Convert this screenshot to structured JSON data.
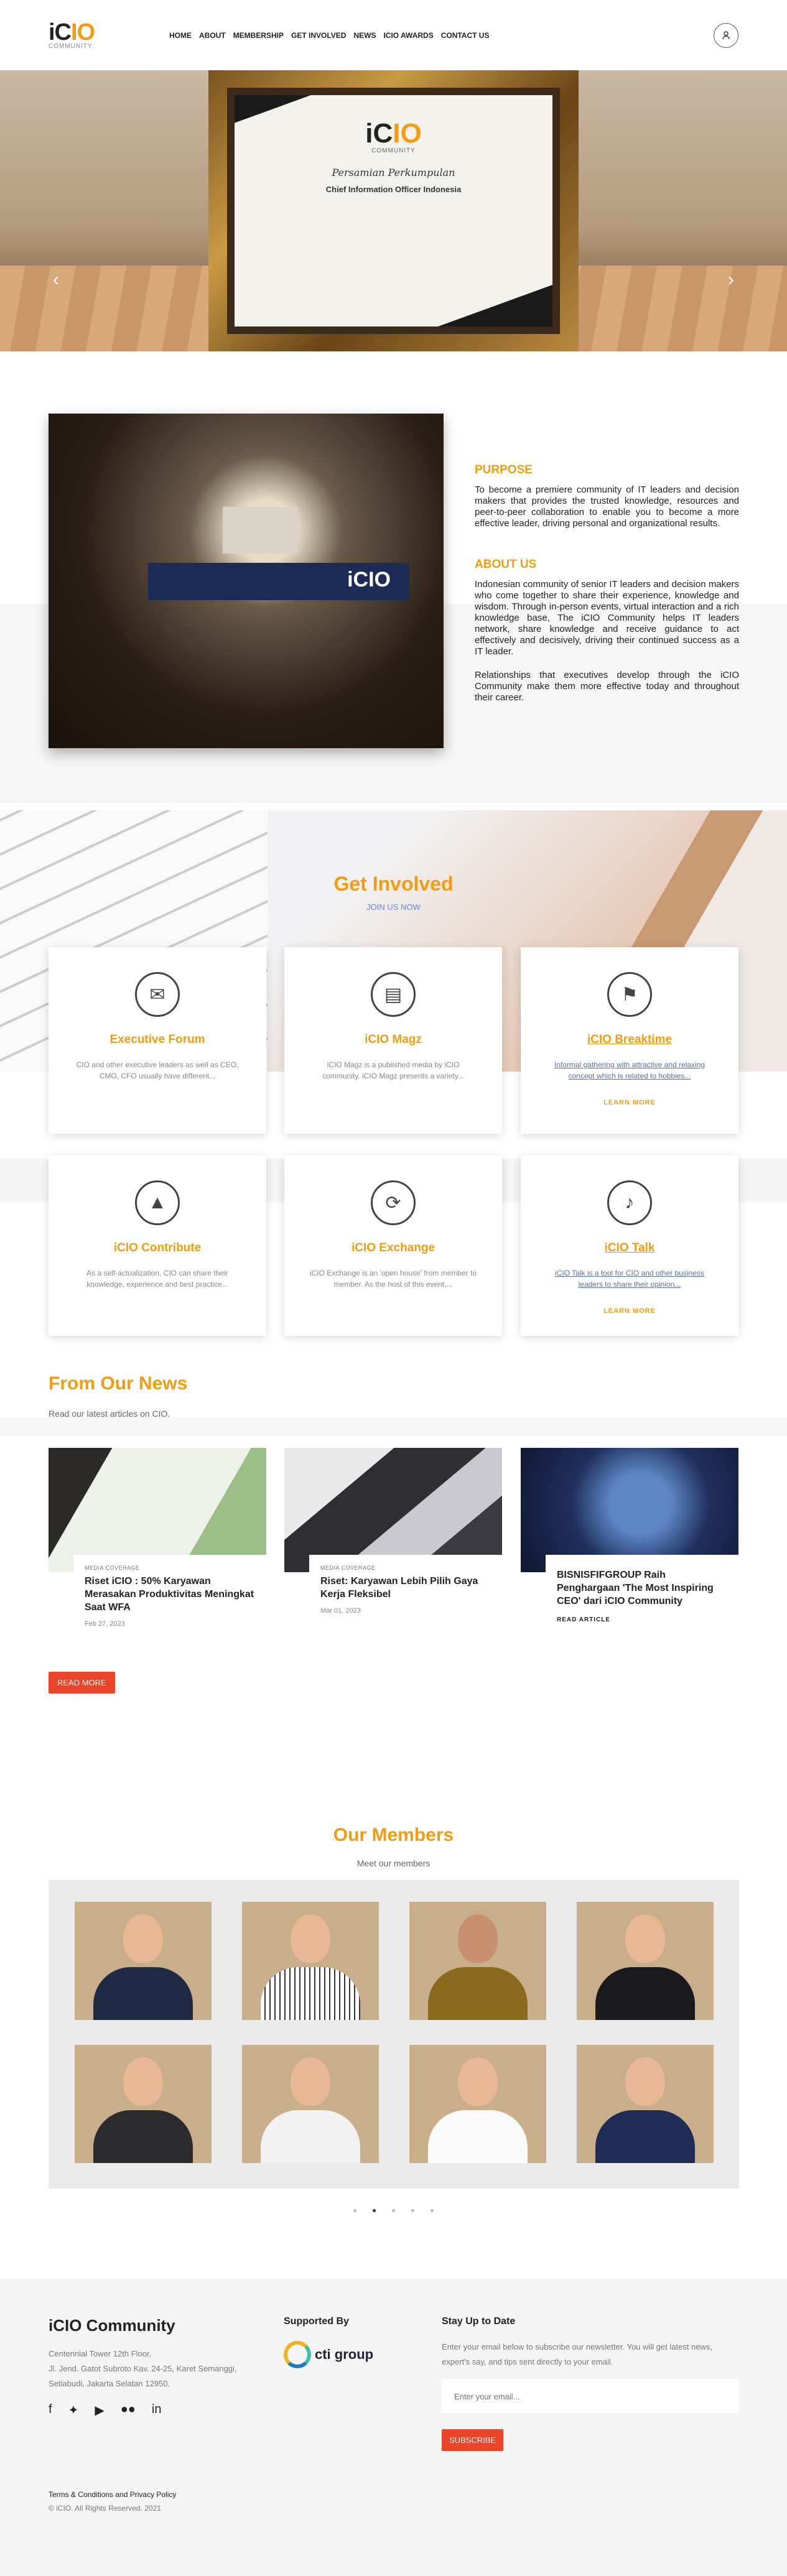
{
  "brand": {
    "logo_main": "iC",
    "logo_accent": "IO",
    "logo_sub": "COMMUNITY"
  },
  "nav": [
    "HOME",
    "ABOUT",
    "MEMBERSHIP",
    "GET INVOLVED",
    "NEWS",
    "ICIO AWARDS",
    "CONTACT US"
  ],
  "hero": {
    "cert_logo_main": "iC",
    "cert_logo_accent": "IO",
    "cert_sub": "COMMUNITY",
    "cert_title": "Persamian Perkumpulan",
    "cert_name": "Chief Information Officer Indonesia",
    "prev": "‹",
    "next": "›"
  },
  "about": {
    "stage_logo": "iCIO",
    "purpose_title": "PURPOSE",
    "purpose_text": "To become a premiere community of IT leaders and decision makers that provides the trusted knowledge, resources and peer-to-peer collaboration to enable you to become a more effective leader, driving personal and organizational results.",
    "about_title": "ABOUT US",
    "about_text_1": "Indonesian community of senior IT leaders and decision makers who come together to share their experience, knowledge and wisdom. Through in-person events, virtual interaction and a rich knowledge base, The iCIO Community helps IT leaders network, share knowledge and receive guidance to act effectively and decisively, driving their continued success as a IT leader.",
    "about_text_2": "Relationships that executives develop through the iCIO Community make them more effective today and throughout their career."
  },
  "involved": {
    "title": "Get Involved",
    "subtitle": "JOIN US NOW",
    "cards": [
      {
        "icon": "chat-icon",
        "glyph": "✉",
        "title": "Executive Forum",
        "text": "CIO and other executive leaders as well as CEO, CMO, CFO usually have different...",
        "more": ""
      },
      {
        "icon": "book-icon",
        "glyph": "▤",
        "title": "iCIO Magz",
        "text": "iCIO Magz is a published media by iCIO community. iCIO Magz presents a variety...",
        "more": ""
      },
      {
        "icon": "golf-icon",
        "glyph": "⚑",
        "title": "iCIO Breaktime",
        "text": "Informal gathering with attractive and relaxing concept which is related to hobbies...",
        "more": "LEARN MORE"
      },
      {
        "icon": "graduation-cap-icon",
        "glyph": "▲",
        "title": "iCIO Contribute",
        "text": "As a self-actualization, CIO can share their knowledge, experience and best practice...",
        "more": ""
      },
      {
        "icon": "exchange-icon",
        "glyph": "⟳",
        "title": "iCIO Exchange",
        "text": "iCIO Exchange is an 'open house' from member to member. As the host of this event,...",
        "more": ""
      },
      {
        "icon": "microphone-icon",
        "glyph": "♪",
        "title": "iCIO Talk",
        "text": "iCIO Talk is a tool for CIO and other business leaders to share their opinion...",
        "more": "LEARN MORE"
      }
    ]
  },
  "news": {
    "title": "From Our News",
    "subtitle": "Read our latest articles on CIO.",
    "posts": [
      {
        "category": "MEDIA COVERAGE",
        "title": "Riset iCIO : 50% Karyawan Merasakan Produktivitas Meningkat Saat WFA",
        "date": "Feb 27, 2023",
        "link": ""
      },
      {
        "category": "MEDIA COVERAGE",
        "title": "Riset: Karyawan Lebih Pilih Gaya Kerja Fleksibel",
        "date": "Mar 01, 2023",
        "link": ""
      },
      {
        "category": "",
        "title": "BISNISFIFGROUP Raih Penghargaan 'The Most Inspiring CEO' dari iCIO Community",
        "date": "",
        "link": "READ ARTICLE"
      }
    ],
    "read_more": "READ MORE"
  },
  "members": {
    "title": "Our Members",
    "subtitle": "Meet our members",
    "count": 8,
    "pages": 5,
    "active_page": 2
  },
  "footer": {
    "title": "iCIO Community",
    "address_1": "Centennial Tower 12th Floor,",
    "address_2": "Jl. Jend. Gatot Subroto Kav. 24-25, Karet Semanggi,",
    "address_3": "Setiabudi, Jakarta Selatan 12950.",
    "supported_title": "Supported By",
    "supporter": "cti group",
    "newsletter_title": "Stay Up to Date",
    "newsletter_text": "Enter your email below to subscribe our newsletter. You will get latest news, expert's say, and tips sent directly to your email.",
    "email_placeholder": "Enter your email...",
    "subscribe": "SUBSCRIBE",
    "terms": "Terms & Conditions and Privacy Policy",
    "copyright": "© iCIO. All Rights Reserved. 2021"
  },
  "colors": {
    "accent": "#f39c12",
    "button": "#e8452a",
    "link": "#5b8dd6"
  }
}
